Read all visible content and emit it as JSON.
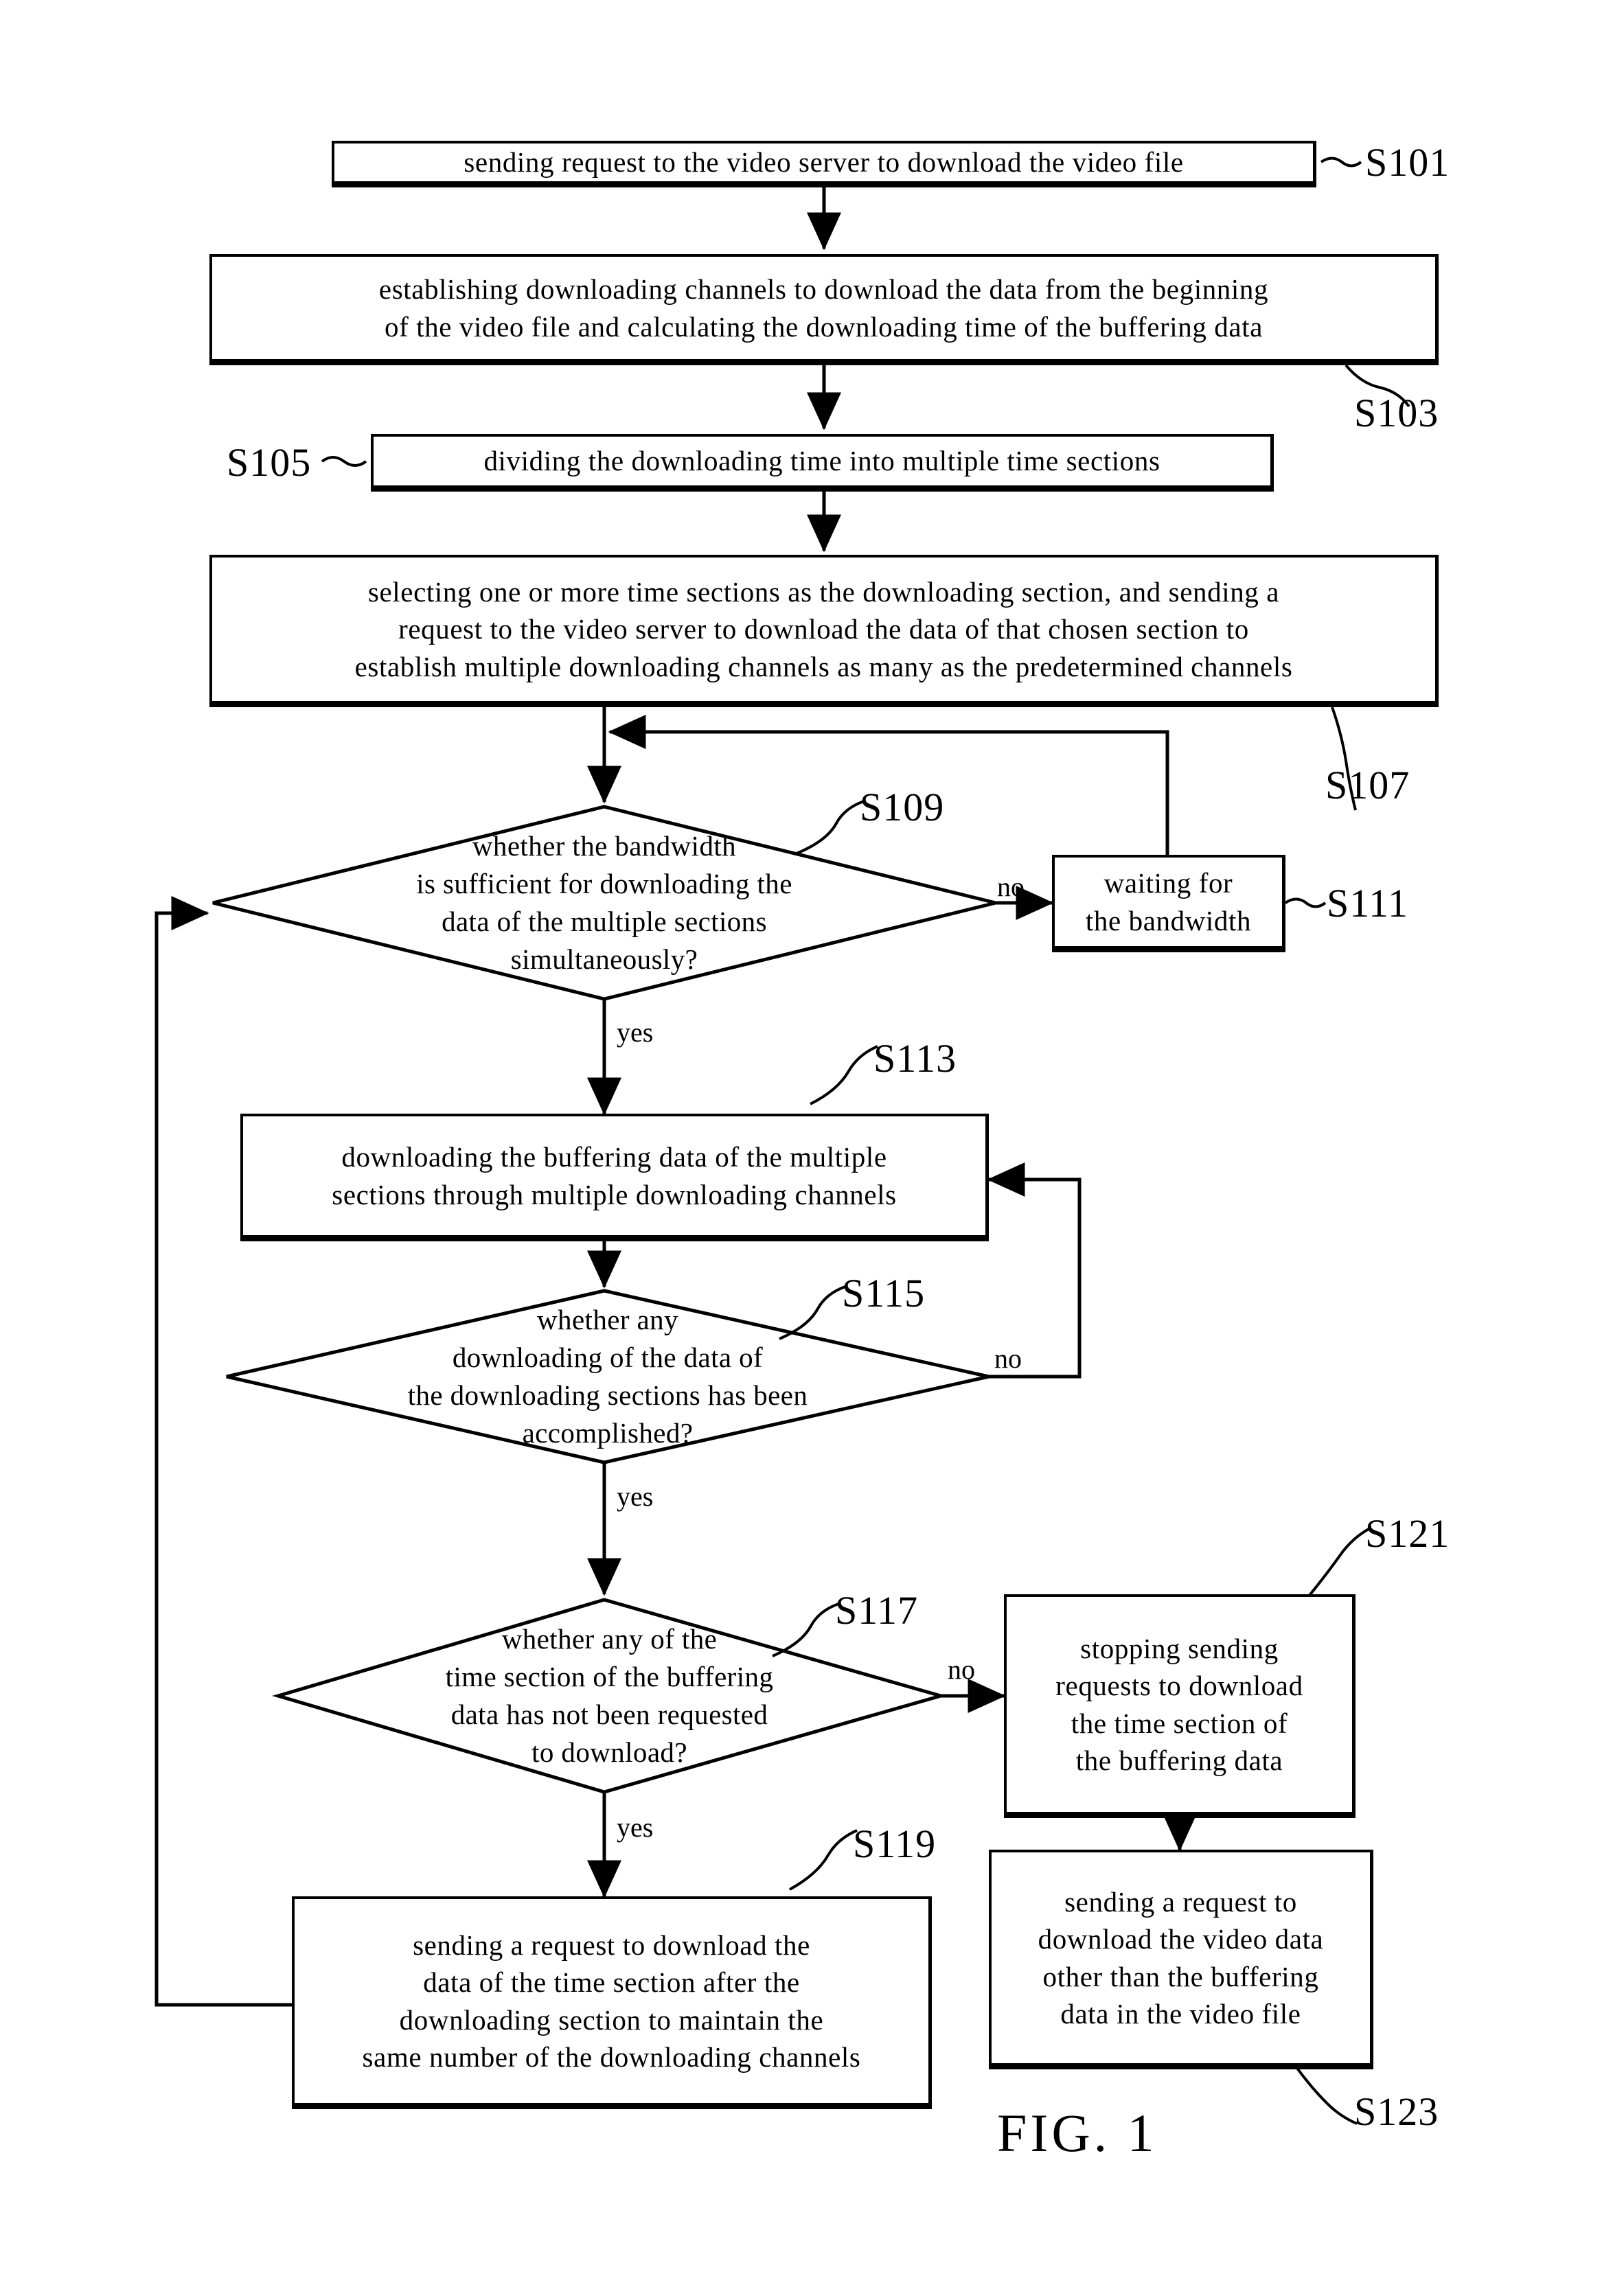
{
  "figure": {
    "caption": "FIG. 1",
    "type": "flowchart"
  },
  "nodes": {
    "s101": {
      "ref": "S101",
      "shape": "process",
      "text": "sending request to the video server to download the video file"
    },
    "s103": {
      "ref": "S103",
      "shape": "process",
      "text": "establishing downloading channels to download the data from the beginning\nof the video file and calculating the downloading time of the buffering data"
    },
    "s105": {
      "ref": "S105",
      "shape": "process",
      "text": "dividing the downloading time into multiple time sections"
    },
    "s107": {
      "ref": "S107",
      "shape": "process",
      "text": "selecting one or more time sections as the downloading section, and sending a\nrequest to the video server to download the data of that chosen section to\nestablish multiple downloading channels as many as the predetermined channels"
    },
    "s109": {
      "ref": "S109",
      "shape": "decision",
      "text": "whether the bandwidth\nis sufficient for downloading the\ndata of the multiple sections\nsimultaneously?"
    },
    "s111": {
      "ref": "S111",
      "shape": "process",
      "text": "waiting for\nthe bandwidth"
    },
    "s113": {
      "ref": "S113",
      "shape": "process",
      "text": "downloading the buffering data of the multiple\nsections through multiple downloading channels"
    },
    "s115": {
      "ref": "S115",
      "shape": "decision",
      "text": "whether any\ndownloading of the data of\nthe downloading sections has been\naccomplished?"
    },
    "s117": {
      "ref": "S117",
      "shape": "decision",
      "text": "whether any of the\ntime section of the buffering\ndata has not been requested\nto download?"
    },
    "s119": {
      "ref": "S119",
      "shape": "process",
      "text": "sending a request to download the\ndata of the time section after the\ndownloading section to maintain the\nsame number of the downloading channels"
    },
    "s121": {
      "ref": "S121",
      "shape": "process",
      "text": "stopping sending\nrequests to download\nthe time section of\nthe buffering data"
    },
    "s123": {
      "ref": "S123",
      "shape": "process",
      "text": "sending a request to\ndownload the video data\nother than the buffering\ndata in the video file"
    }
  },
  "edge_labels": {
    "s109_no": "no",
    "s109_yes": "yes",
    "s115_no": "no",
    "s115_yes": "yes",
    "s117_no": "no",
    "s117_yes": "yes"
  },
  "colors": {
    "stroke": "#000000",
    "background": "#ffffff"
  }
}
